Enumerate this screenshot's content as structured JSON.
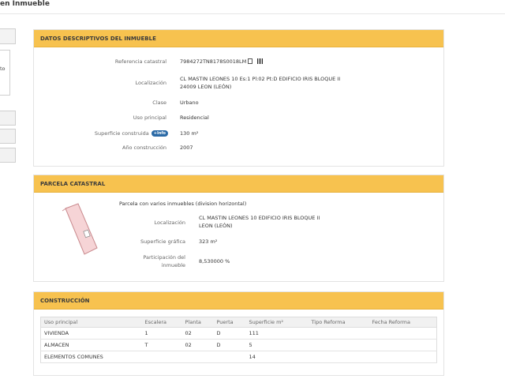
{
  "page": {
    "title": "en Inmueble"
  },
  "left": {
    "side_text": "to"
  },
  "descriptivos": {
    "title": "DATOS DESCRIPTIVOS DEL INMUEBLE",
    "rows": [
      {
        "label": "Referencia catastral",
        "value": "7984272TN8178S0018LM"
      },
      {
        "label": "Localización",
        "value": "CL MASTIN LEONES 10 Es:1 Pl:02 Pt:D EDIFICIO IRIS BLOQUE II",
        "value2": "24009 LEON (LEÓN)"
      },
      {
        "label": "Clase",
        "value": "Urbano"
      },
      {
        "label": "Uso principal",
        "value": "Residencial"
      },
      {
        "label": "Superficie construida",
        "badge": "+Info",
        "value": "130 m²"
      },
      {
        "label": "Año construcción",
        "value": "2007"
      }
    ]
  },
  "parcela": {
    "title": "PARCELA CATASTRAL",
    "subtitle": "Parcela con varios inmuebles (division horizontal)",
    "loc_label": "Localización",
    "loc_value": "CL MASTIN LEONES 10 EDIFICIO IRIS BLOQUE II",
    "loc_value2": "LEON (LEÓN)",
    "sup_label": "Superficie gráfica",
    "sup_value": "323 m²",
    "part_label": "Participación del",
    "part_label2": "inmueble",
    "part_value": "8,530000 %"
  },
  "construccion": {
    "title": "CONSTRUCCIÓN",
    "headers": [
      "Uso principal",
      "Escalera",
      "Planta",
      "Puerta",
      "Superficie m²",
      "Tipo Reforma",
      "Fecha Reforma"
    ],
    "rows": [
      [
        "VIVIENDA",
        "1",
        "02",
        "D",
        "111",
        "",
        ""
      ],
      [
        "ALMACEN",
        "T",
        "02",
        "D",
        "5",
        "",
        ""
      ],
      [
        "ELEMENTOS COMUNES",
        "",
        "",
        "",
        "14",
        "",
        ""
      ]
    ]
  },
  "colors": {
    "header_bg": "#f7c24f",
    "badge": "#2b6aa6",
    "parcel_fill": "#f6d4d6"
  }
}
